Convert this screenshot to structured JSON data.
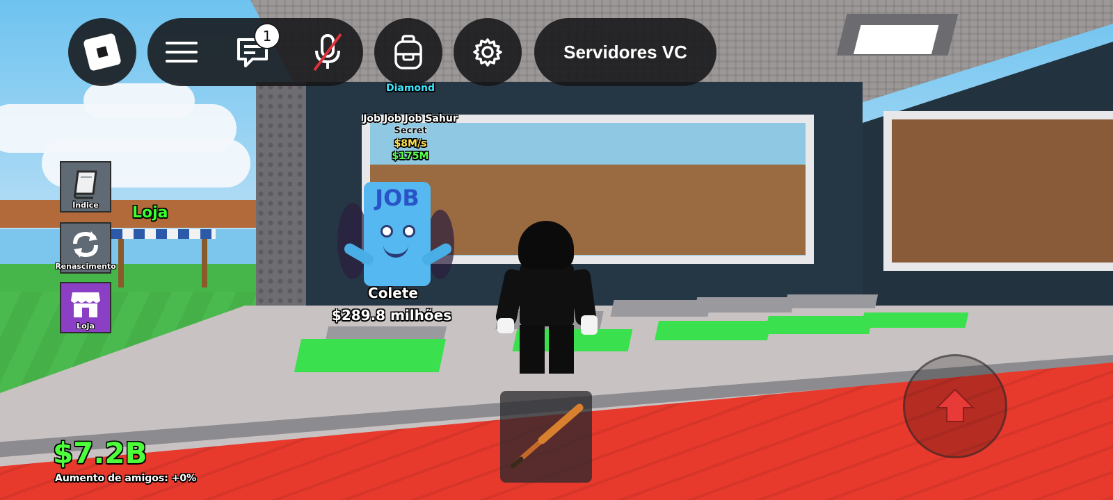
{
  "top_bar": {
    "roblox_logo": "roblox-logo-icon",
    "menu_icon": "hamburger-menu-icon",
    "chat_icon": "chat-icon",
    "chat_badge": "1",
    "mic_icon": "microphone-muted-icon",
    "backpack_icon": "backpack-icon",
    "settings_icon": "gear-icon",
    "voice_servers_label": "Servidores VC"
  },
  "side_menu": {
    "items": [
      {
        "label": "Índice",
        "icon": "book-index-icon",
        "color": "#5f6a74"
      },
      {
        "label": "Renascimento",
        "icon": "rebirth-arrows-icon",
        "color": "#5f6a74"
      },
      {
        "label": "Loja",
        "icon": "shop-store-icon",
        "color": "#8a3fc4"
      }
    ]
  },
  "world": {
    "shop_sign": "Loja",
    "brainrot": {
      "rarity": "Diamond",
      "name": "Job Job Job Sahur",
      "mutation": "Secret",
      "income": "$8M/s",
      "price": "$175M",
      "body_text": "JOB"
    },
    "collect": {
      "label": "Colete",
      "amount": "$289.8 milhões"
    }
  },
  "hud": {
    "money": "$7.2B",
    "friend_boost": "Aumento de amigos: +0%",
    "tool_icon": "baseball-bat-icon",
    "jump_icon": "jump-arrow-icon"
  },
  "colors": {
    "money_green": "#4dff3a",
    "rarity_cyan": "#3fe6ff",
    "income_yellow": "#ffe24a",
    "price_green": "#59ff4a",
    "pad_green": "#3be04e",
    "floor_red": "#e8392d"
  }
}
